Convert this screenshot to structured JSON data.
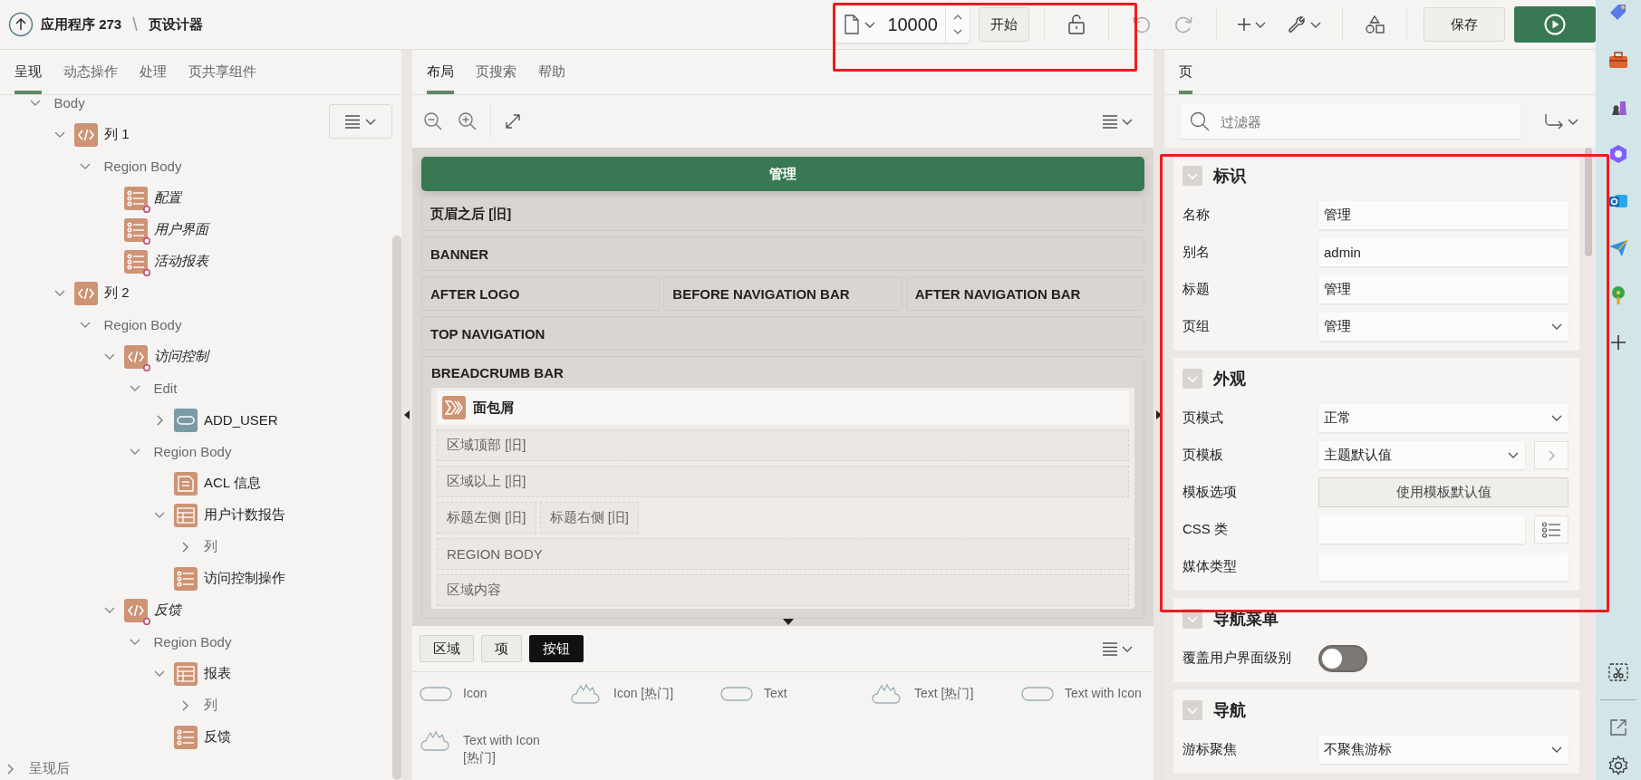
{
  "header": {
    "app": "应用程序 273",
    "separator": "\\",
    "page": "页设计器"
  },
  "toolbar": {
    "page_number": "10000",
    "go": "开始",
    "save": "保存",
    "highlighted": true
  },
  "left_tabs": [
    {
      "label": "呈现",
      "selected": true
    },
    {
      "label": "动态操作",
      "selected": false
    },
    {
      "label": "处理",
      "selected": false
    },
    {
      "label": "页共享组件",
      "selected": false
    }
  ],
  "tree": {
    "scrolled_branch": [
      {
        "label": "Body",
        "expanded": true,
        "children": [
          {
            "label": "列 1",
            "kind": "region",
            "conditional": false,
            "expanded": true,
            "children": [
              {
                "label": "Region Body",
                "expanded": true,
                "children": [
                  {
                    "label": "配置",
                    "kind": "list",
                    "conditional": true
                  },
                  {
                    "label": "用户界面",
                    "kind": "list",
                    "conditional": true
                  },
                  {
                    "label": "活动报表",
                    "kind": "list",
                    "conditional": true
                  }
                ]
              }
            ]
          },
          {
            "label": "列 2",
            "kind": "region",
            "conditional": false,
            "expanded": true,
            "children": [
              {
                "label": "Region Body",
                "expanded": true,
                "children": [
                  {
                    "label": "访问控制",
                    "kind": "region",
                    "conditional": true,
                    "expanded": true,
                    "children": [
                      {
                        "label": "Edit",
                        "expanded": true,
                        "children": [
                          {
                            "label": "ADD_USER",
                            "kind": "button",
                            "conditional": false,
                            "expanded": false
                          }
                        ]
                      },
                      {
                        "label": "Region Body",
                        "expanded": true,
                        "children": [
                          {
                            "label": "ACL 信息",
                            "kind": "dynamic",
                            "conditional": false
                          },
                          {
                            "label": "用户计数报告",
                            "kind": "report",
                            "conditional": false,
                            "expanded": true,
                            "children": [
                              {
                                "label": "列",
                                "expanded": false
                              }
                            ]
                          },
                          {
                            "label": "访问控制操作",
                            "kind": "list",
                            "conditional": false
                          }
                        ]
                      }
                    ]
                  },
                  {
                    "label": "反馈",
                    "kind": "region",
                    "conditional": true,
                    "expanded": true,
                    "children": [
                      {
                        "label": "Region Body",
                        "expanded": true,
                        "children": [
                          {
                            "label": "报表",
                            "kind": "report",
                            "conditional": false,
                            "expanded": true,
                            "children": [
                              {
                                "label": "列",
                                "expanded": false
                              }
                            ]
                          },
                          {
                            "label": "反馈",
                            "kind": "list",
                            "conditional": false
                          }
                        ]
                      }
                    ]
                  }
                ]
              }
            ]
          }
        ]
      }
    ],
    "items": [
      {
        "label": "呈现后",
        "expanded": false
      }
    ]
  },
  "middle_tabs": [
    {
      "label": "布局",
      "selected": true
    },
    {
      "label": "页搜索",
      "selected": false
    },
    {
      "label": "帮助",
      "selected": false
    }
  ],
  "layout": {
    "page_title": "管理",
    "positions": [
      {
        "cells": [
          "页眉之后 [旧]"
        ]
      },
      {
        "cells": [
          "BANNER"
        ]
      },
      {
        "cells": [
          "AFTER LOGO",
          "BEFORE NAVIGATION BAR",
          "AFTER NAVIGATION BAR"
        ]
      },
      {
        "cells": [
          "TOP NAVIGATION"
        ]
      },
      {
        "cells": [
          "BREADCRUMB BAR"
        ],
        "region": {
          "title": "面包屑",
          "slots": [
            {
              "cells": [
                "区域顶部 [旧]"
              ]
            },
            {
              "cells": [
                "区域以上 [旧]"
              ]
            },
            {
              "cells": [
                "标题左侧 [旧]",
                "标题右侧 [旧]"
              ]
            },
            {
              "cells": [
                "REGION BODY"
              ]
            },
            {
              "cells": [
                "区域内容"
              ]
            }
          ]
        }
      }
    ]
  },
  "gallery": {
    "tabs": [
      {
        "label": "区域",
        "selected": false
      },
      {
        "label": "项",
        "selected": false
      },
      {
        "label": "按钮",
        "selected": true
      }
    ],
    "items": [
      {
        "label": "Icon",
        "kind": "plain"
      },
      {
        "label": "Icon [热门]",
        "kind": "hot"
      },
      {
        "label": "Text",
        "kind": "plain"
      },
      {
        "label": "Text [热门]",
        "kind": "hot"
      },
      {
        "label": "Text with Icon",
        "kind": "plain"
      },
      {
        "label": "Text with Icon [热门]",
        "kind": "hot"
      }
    ]
  },
  "properties": {
    "tabs": [
      {
        "label": "页",
        "selected": true
      }
    ],
    "filter_placeholder": "过滤器",
    "highlighted": true,
    "sections": [
      {
        "title": "标识",
        "expanded": true,
        "rows": [
          {
            "label": "名称",
            "kind": "text",
            "value": "管理"
          },
          {
            "label": "别名",
            "kind": "text",
            "value": "admin"
          },
          {
            "label": "标题",
            "kind": "text",
            "value": "管理"
          },
          {
            "label": "页组",
            "kind": "select",
            "value": "管理"
          }
        ]
      },
      {
        "title": "外观",
        "expanded": true,
        "rows": [
          {
            "label": "页模式",
            "kind": "select",
            "value": "正常"
          },
          {
            "label": "页模板",
            "kind": "select_link",
            "value": "主题默认值"
          },
          {
            "label": "模板选项",
            "kind": "button",
            "value": "使用模板默认值"
          },
          {
            "label": "CSS 类",
            "kind": "text_picker"
          },
          {
            "label": "媒体类型",
            "kind": "text"
          }
        ]
      },
      {
        "title": "导航菜单",
        "expanded": true,
        "rows": [
          {
            "label": "覆盖用户界面级别",
            "kind": "switch",
            "on": false
          }
        ]
      },
      {
        "title": "导航",
        "expanded": true,
        "rows": [
          {
            "label": "游标聚焦",
            "kind": "select",
            "value": "不聚焦游标"
          }
        ]
      }
    ]
  }
}
